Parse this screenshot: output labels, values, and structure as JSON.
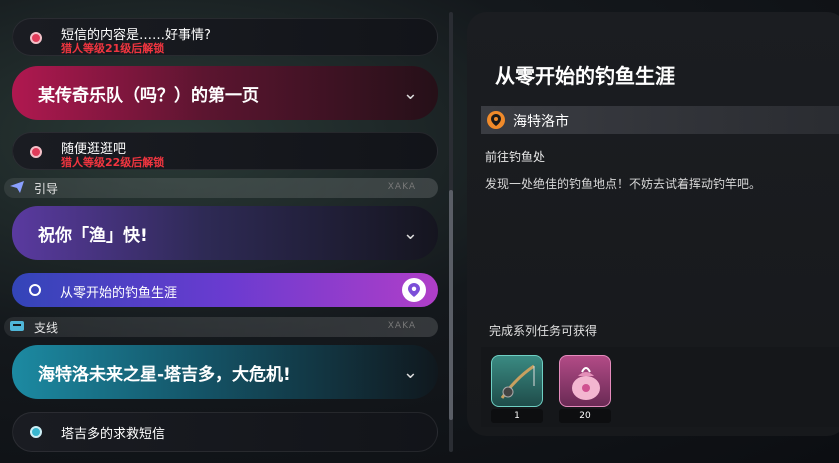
{
  "quest_list": {
    "items": [
      {
        "title": "短信的内容是……好事情?",
        "lock": "猎人等级21级后解锁"
      },
      {
        "banner": "某传奇乐队（吗？）的第一页"
      },
      {
        "title": "随便逛逛吧",
        "lock": "猎人等级22级后解锁"
      },
      {
        "category": "引导",
        "logo": "XAKA"
      },
      {
        "banner": "祝你「渔」快!"
      },
      {
        "active": "从零开始的钓鱼生涯"
      },
      {
        "category": "支线",
        "logo": "XAKA"
      },
      {
        "banner": "海特洛未来之星-塔吉多，大危机!"
      },
      {
        "title": "塔吉多的求救短信"
      }
    ]
  },
  "detail": {
    "title": "从零开始的钓鱼生涯",
    "location": "海特洛市",
    "objective": "前往钓鱼处",
    "description": "发现一处绝佳的钓鱼地点！不妨去试着挥动钓竿吧。",
    "reward_label": "完成系列任务可获得",
    "rewards": [
      {
        "icon": "fishing-rod-icon",
        "count": "1"
      },
      {
        "icon": "gift-bag-icon",
        "count": "20"
      }
    ]
  },
  "colors": {
    "accent_red": "#f0353f",
    "active_gradient": [
      "#3345b8",
      "#b03ec8"
    ],
    "location_orange": "#f08a2a"
  }
}
